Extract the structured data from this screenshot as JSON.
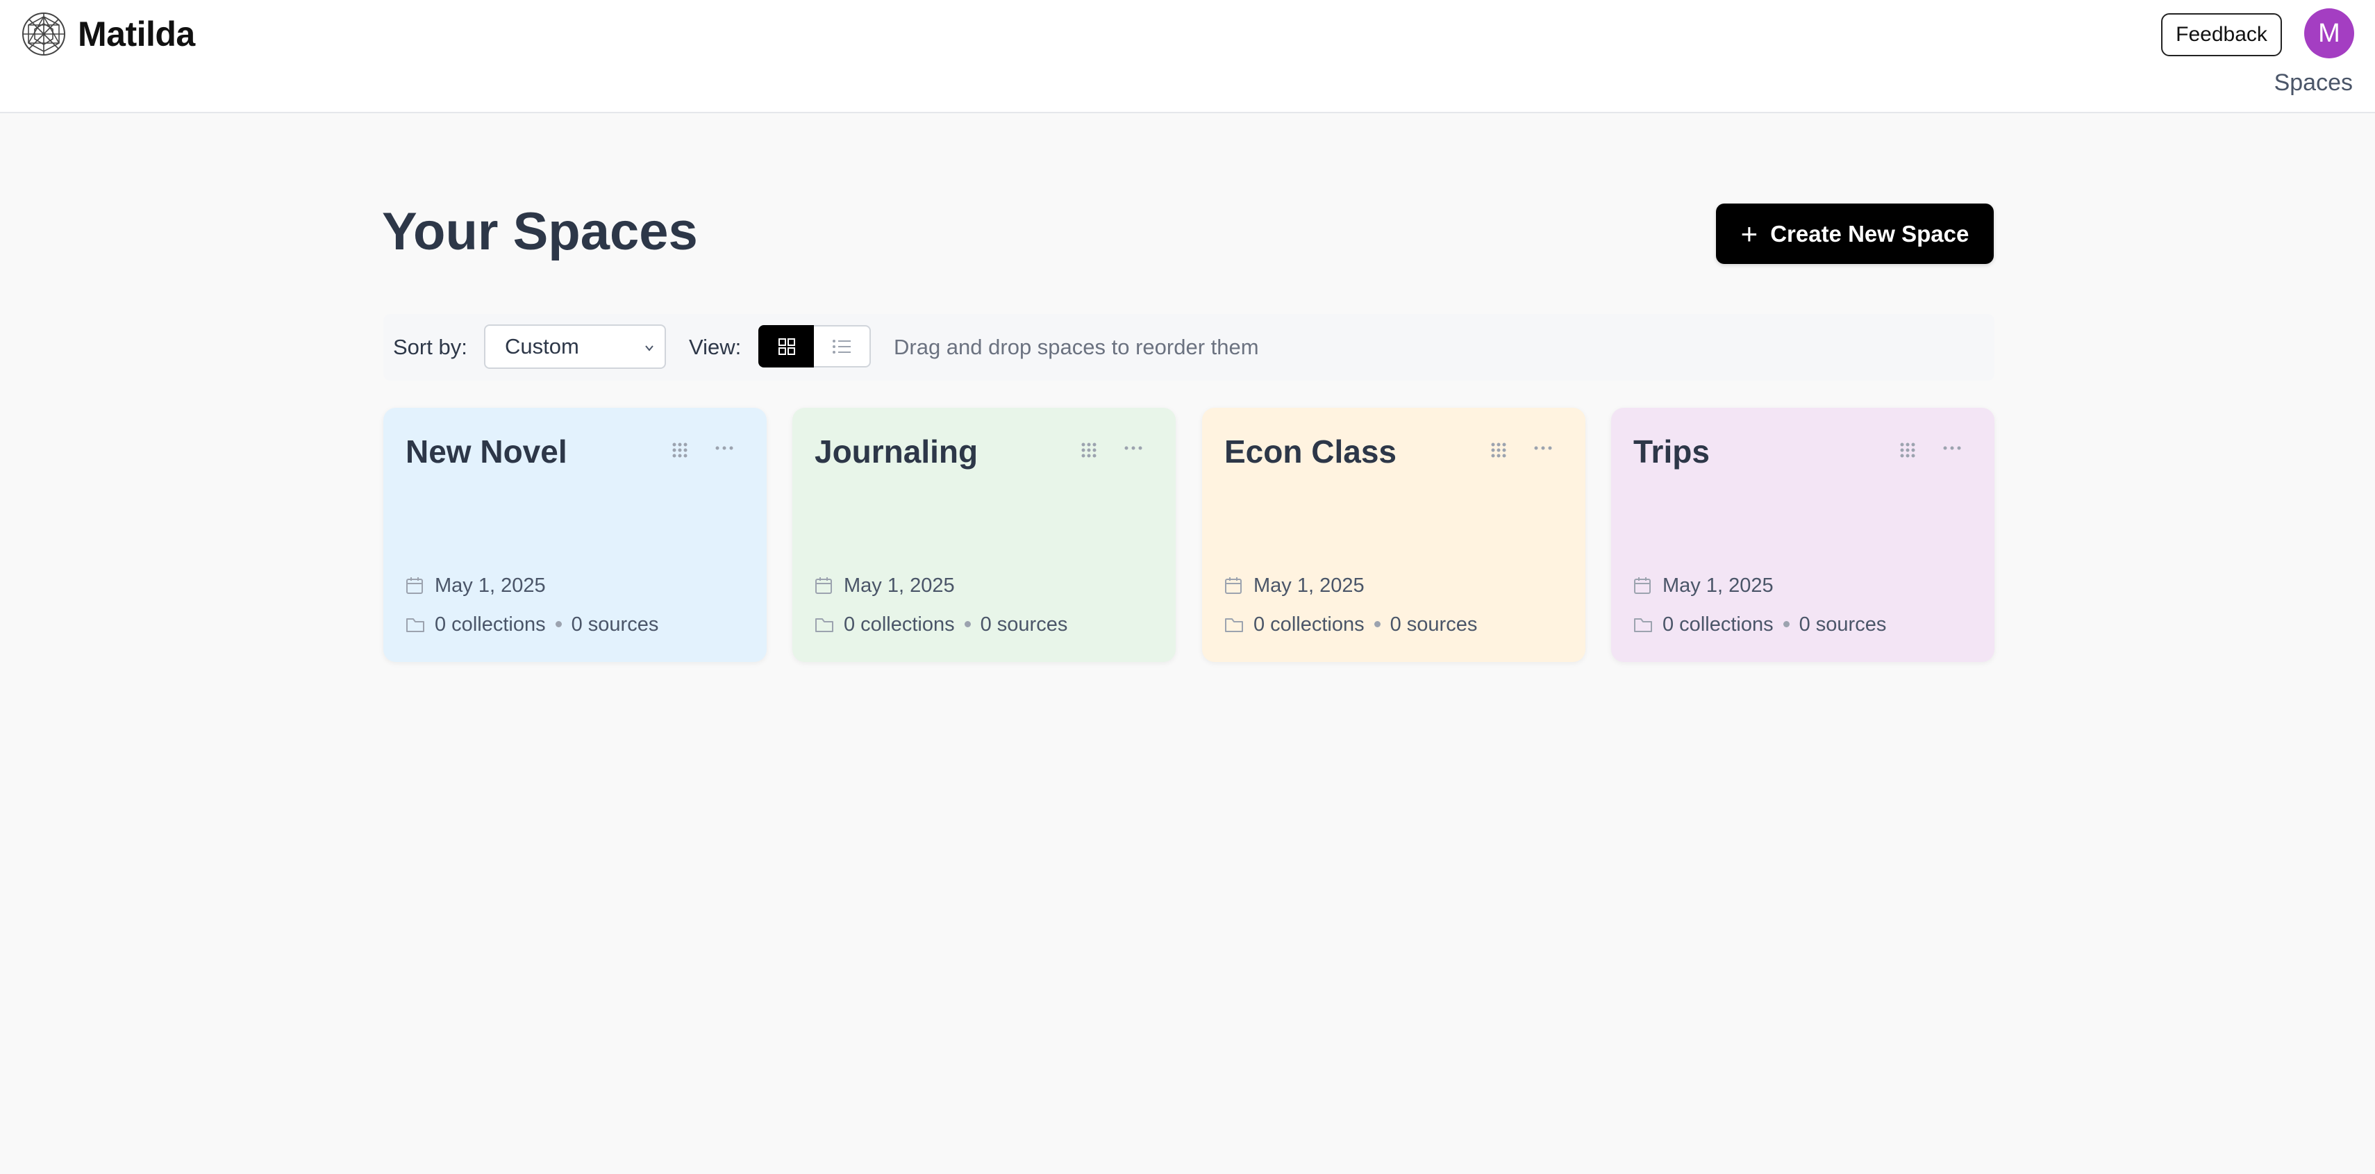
{
  "app": {
    "name": "Matilda"
  },
  "header": {
    "feedback_label": "Feedback",
    "avatar_initial": "M",
    "nav_spaces": "Spaces"
  },
  "main": {
    "title": "Your Spaces",
    "create_label": "Create New Space",
    "sort_label": "Sort by:",
    "sort_value": "Custom",
    "view_label": "View:",
    "view_selected": "grid",
    "hint": "Drag and drop spaces to reorder them"
  },
  "spaces": [
    {
      "title": "New Novel",
      "date": "May 1, 2025",
      "collections": "0 collections",
      "sources": "0 sources",
      "color": "#e3f2fd"
    },
    {
      "title": "Journaling",
      "date": "May 1, 2025",
      "collections": "0 collections",
      "sources": "0 sources",
      "color": "#e8f5e9"
    },
    {
      "title": "Econ Class",
      "date": "May 1, 2025",
      "collections": "0 collections",
      "sources": "0 sources",
      "color": "#fff3e0"
    },
    {
      "title": "Trips",
      "date": "May 1, 2025",
      "collections": "0 collections",
      "sources": "0 sources",
      "color": "#f3e5f5"
    }
  ],
  "colors": {
    "avatar": "#a43ec2",
    "primary_button": "#000000"
  }
}
